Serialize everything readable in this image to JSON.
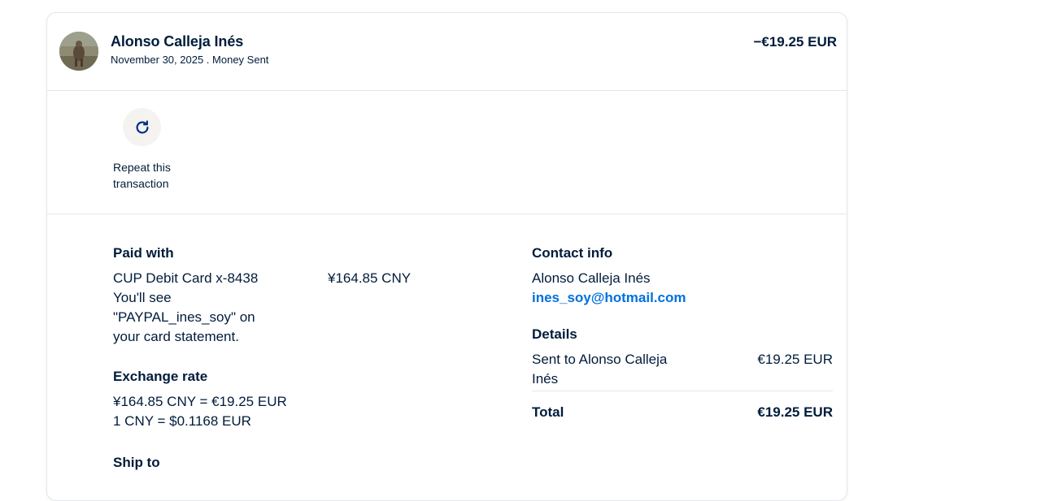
{
  "header": {
    "name": "Alonso Calleja Inés",
    "date": "November 30, 2025",
    "separator": " . ",
    "type": "Money Sent",
    "amount": "−€19.25 EUR"
  },
  "actions": {
    "repeat_label": "Repeat this transaction",
    "repeat_icon": "refresh-icon"
  },
  "paid_with": {
    "title": "Paid with",
    "card": "CUP Debit Card x-8438",
    "amount": "¥164.85 CNY",
    "statement_note": "You'll see \"PAYPAL_ines_soy\" on your card statement."
  },
  "exchange": {
    "title": "Exchange rate",
    "line1": "¥164.85 CNY = €19.25 EUR",
    "line2": "1 CNY = $0.1168 EUR"
  },
  "ship_to": {
    "title": "Ship to"
  },
  "contact": {
    "title": "Contact info",
    "name": "Alonso Calleja Inés",
    "email": "ines_soy@hotmail.com"
  },
  "details": {
    "title": "Details",
    "sent_label": "Sent to Alonso Calleja Inés",
    "sent_amount": "€19.25 EUR",
    "total_label": "Total",
    "total_amount": "€19.25 EUR"
  },
  "colors": {
    "text": "#001c3b",
    "link": "#0070e0",
    "icon": "#003087",
    "border": "#e6e7ea"
  }
}
